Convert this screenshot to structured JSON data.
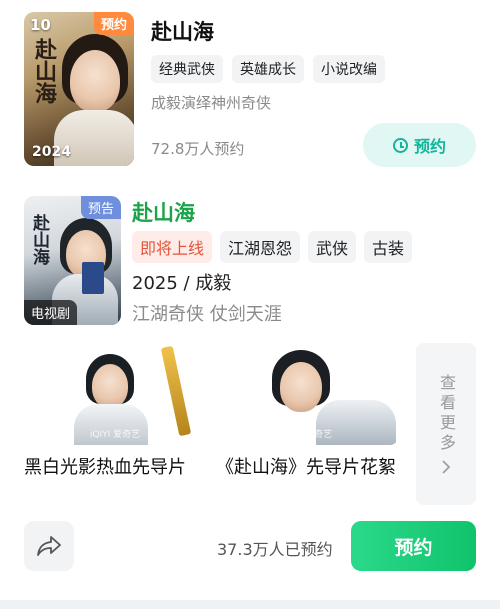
{
  "colors": {
    "accent_green": "#1aa34a",
    "reserve_teal": "#12b59a",
    "badge_orange": "#ff8a3d",
    "badge_blue": "#6f8fdc",
    "soon_red": "#e2553b"
  },
  "card1": {
    "rank": "10",
    "badge": "预约",
    "year": "2024",
    "title": "赴山海",
    "tags": [
      "经典武侠",
      "英雄成长",
      "小说改编"
    ],
    "subtitle": "成毅演绎神州奇侠",
    "reserve_count": "72.8万人预约",
    "reserve_button": "预约",
    "reserve_icon": "alarm-clock-icon"
  },
  "card2": {
    "badge": "预告",
    "type_badge": "电视剧",
    "title": "赴山海",
    "tags": [
      "即将上线",
      "江湖恩怨",
      "武侠",
      "古装"
    ],
    "year_cast": "2025 / 成毅",
    "subtitle": "江湖奇侠 仗剑天涯",
    "trailers": [
      {
        "title": "黑白光影热血先导片",
        "watermark": "iQIYI 爱奇艺"
      },
      {
        "title": "《赴山海》先导片花絮",
        "watermark": "iQIYI 爱奇艺"
      }
    ],
    "more_label": "查看更多",
    "more_icon": "chevron-right-icon",
    "share_icon": "share-arrow-icon",
    "reserve_count": "37.3万人已预约",
    "reserve_button": "预约"
  }
}
